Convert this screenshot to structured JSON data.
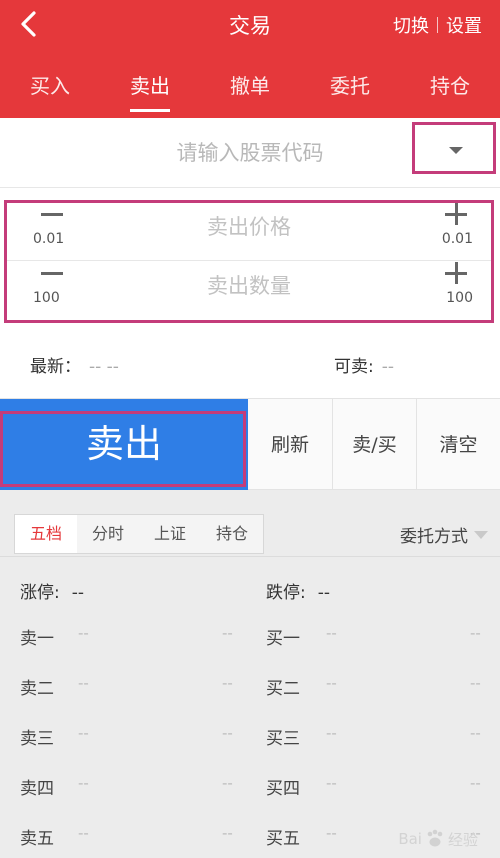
{
  "header": {
    "title": "交易",
    "switch_label": "切换",
    "settings_label": "设置",
    "tabs": [
      {
        "label": "买入"
      },
      {
        "label": "卖出"
      },
      {
        "label": "撤单"
      },
      {
        "label": "委托"
      },
      {
        "label": "持仓"
      }
    ],
    "active_tab": "卖出"
  },
  "stock": {
    "placeholder": "请输入股票代码"
  },
  "price": {
    "placeholder": "卖出价格",
    "minus_step": "0.01",
    "plus_step": "0.01"
  },
  "quantity": {
    "placeholder": "卖出数量",
    "minus_step": "100",
    "plus_step": "100"
  },
  "info": {
    "latest_label": "最新：",
    "latest_value": "-- --",
    "sellable_label": "可卖:",
    "sellable_value": "--"
  },
  "actions": {
    "sell_label": "卖出",
    "refresh_label": "刷新",
    "sellbuy_label": "卖/买",
    "clear_label": "清空"
  },
  "market": {
    "tabs": [
      {
        "label": "五档"
      },
      {
        "label": "分时"
      },
      {
        "label": "上证"
      },
      {
        "label": "持仓"
      }
    ],
    "active_tab": "五档",
    "entrust_label": "委托方式",
    "limit_up_label": "涨停:",
    "limit_up_value": "--",
    "limit_down_label": "跌停:",
    "limit_down_value": "--",
    "book": [
      {
        "sell": "卖一",
        "sell_price": "--",
        "sell_qty": "--",
        "buy": "买一",
        "buy_price": "--",
        "buy_qty": "--"
      },
      {
        "sell": "卖二",
        "sell_price": "--",
        "sell_qty": "--",
        "buy": "买二",
        "buy_price": "--",
        "buy_qty": "--"
      },
      {
        "sell": "卖三",
        "sell_price": "--",
        "sell_qty": "--",
        "buy": "买三",
        "buy_price": "--",
        "buy_qty": "--"
      },
      {
        "sell": "卖四",
        "sell_price": "--",
        "sell_qty": "--",
        "buy": "买四",
        "buy_price": "--",
        "buy_qty": "--"
      },
      {
        "sell": "卖五",
        "sell_price": "--",
        "sell_qty": "--",
        "buy": "买五",
        "buy_price": "--",
        "buy_qty": "--"
      }
    ]
  },
  "watermark": {
    "text_left": "Bai",
    "text_right": "经验"
  },
  "colors": {
    "header_red": "#e5383b",
    "sell_blue": "#2f7ee6",
    "highlight_outline": "#c43c7a"
  }
}
